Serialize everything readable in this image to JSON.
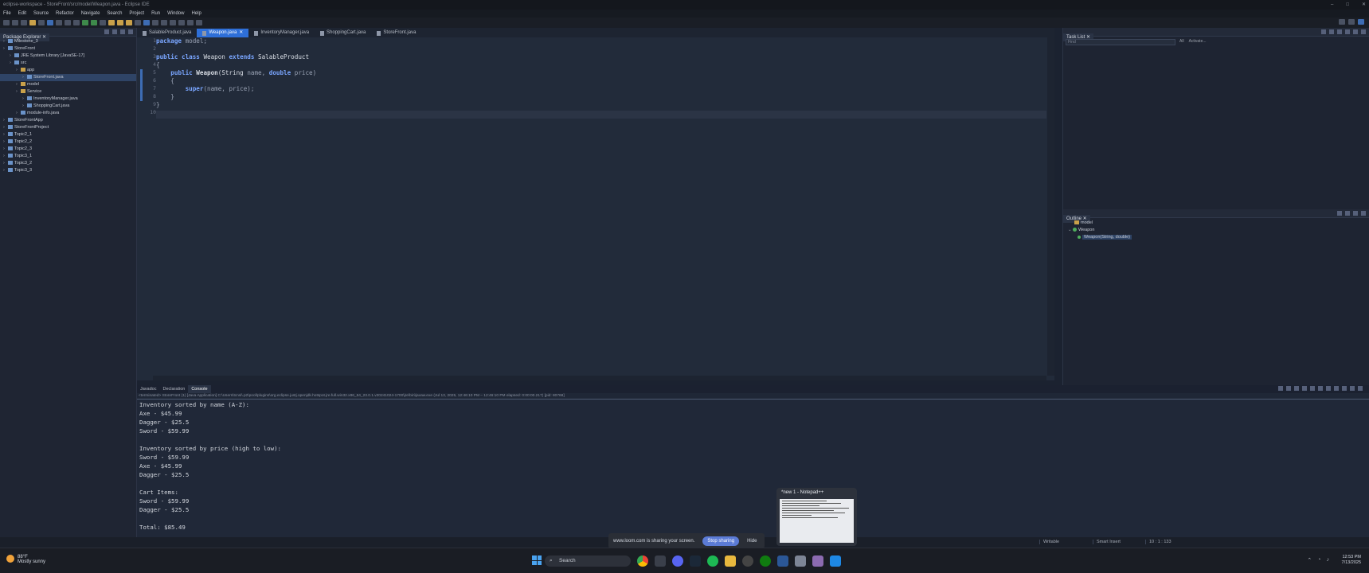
{
  "window": {
    "title": "eclipse-workspace - StoreFront/src/model/Weapon.java - Eclipse IDE"
  },
  "menu": [
    "File",
    "Edit",
    "Source",
    "Refactor",
    "Navigate",
    "Search",
    "Project",
    "Run",
    "Window",
    "Help"
  ],
  "package_explorer": {
    "tab": "Package Explorer",
    "items": [
      {
        "label": "Milestone_3",
        "depth": 0
      },
      {
        "label": "StoreFront",
        "depth": 0
      },
      {
        "label": "JRE System Library [JavaSE-17]",
        "depth": 1
      },
      {
        "label": "src",
        "depth": 1
      },
      {
        "label": "app",
        "depth": 2
      },
      {
        "label": "StoreFront.java",
        "depth": 3
      },
      {
        "label": "model",
        "depth": 2
      },
      {
        "label": "Service",
        "depth": 2
      },
      {
        "label": "InventoryManager.java",
        "depth": 3
      },
      {
        "label": "ShoppingCart.java",
        "depth": 3
      },
      {
        "label": "module-info.java",
        "depth": 2
      },
      {
        "label": "StoreFrontApp",
        "depth": 0
      },
      {
        "label": "StoreFrontProject",
        "depth": 0
      },
      {
        "label": "Topic2_1",
        "depth": 0
      },
      {
        "label": "Topic2_2",
        "depth": 0
      },
      {
        "label": "Topic2_3",
        "depth": 0
      },
      {
        "label": "Topic3_1",
        "depth": 0
      },
      {
        "label": "Topic3_2",
        "depth": 0
      },
      {
        "label": "Topic3_3",
        "depth": 0
      }
    ]
  },
  "editor": {
    "tabs": [
      {
        "label": "SalableProduct.java",
        "active": false
      },
      {
        "label": "Weapon.java",
        "active": true
      },
      {
        "label": "InventoryManager.java",
        "active": false
      },
      {
        "label": "ShoppingCart.java",
        "active": false
      },
      {
        "label": "StoreFront.java",
        "active": false
      }
    ],
    "line_numbers": [
      "1",
      "2",
      "3",
      "4",
      "5",
      "6",
      "7",
      "8",
      "9",
      "10"
    ],
    "code": {
      "l1_kw": "package",
      "l1_rest": " model;",
      "l3_kw1": "public class",
      "l3_name": " Weapon ",
      "l3_kw2": "extends",
      "l3_rest": " SalableProduct",
      "l4": "{",
      "l5_kw": "public",
      "l5_name": " Weapon",
      "l5_p1": "(String ",
      "l5_p2": "name, ",
      "l5_kw2": "double",
      "l5_p3": " price)",
      "l6": "{",
      "l7_kw": "super",
      "l7_rest": "(name, price);",
      "l8": "}",
      "l9": "}"
    }
  },
  "task_list": {
    "tab": "Task List",
    "search_placeholder": "Find",
    "filter_all": "All",
    "filter_activate": "Activate..."
  },
  "outline": {
    "tab": "Outline",
    "items": [
      "model",
      "Weapon",
      "Weapon(String, double)"
    ]
  },
  "console": {
    "tabs": [
      "Javadoc",
      "Declaration",
      "Console"
    ],
    "header": "<terminated> StoreFront (1) [Java Application] C:\\Users\\tcnsi\\.p2\\pool\\plugins\\org.eclipse.justj.openjdk.hotspot.jre.full.win32.x86_64_23.0.1.v20241024-1700\\jre\\bin\\javaw.exe  (Jul 13, 2025, 12:46:10 PM – 12:46:10 PM elapsed: 0:00:00.217) [pid: 80768]",
    "lines": [
      "Inventory sorted by name (A-Z):",
      "Axe - $45.99",
      "Dagger - $25.5",
      "Sword - $59.99",
      "",
      "Inventory sorted by price (high to low):",
      "Sword - $59.99",
      "Axe - $45.99",
      "Dagger - $25.5",
      "",
      "Cart Items:",
      "Sword - $59.99",
      "Dagger - $25.5",
      "",
      "Total: $85.49"
    ]
  },
  "status": {
    "writable": "Writable",
    "insert_mode": "Smart Insert",
    "position": "10 : 1 : 133"
  },
  "loom": {
    "message": "www.loom.com is sharing your screen.",
    "stop": "Stop sharing",
    "hide": "Hide"
  },
  "notepad_preview": {
    "title": "*new 1 - Notepad++"
  },
  "taskbar": {
    "weather_temp": "88°F",
    "weather_desc": "Mostly sunny",
    "search": "Search",
    "time": "12:53 PM",
    "date": "7/13/2025"
  }
}
